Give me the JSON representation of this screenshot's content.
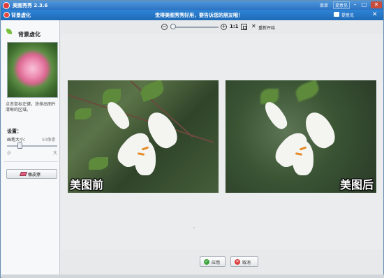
{
  "titlebar": {
    "app_title": "美图秀秀 2.3.6",
    "menu_label": "菜单",
    "feedback_label": "提意见",
    "minimize_glyph": "–",
    "maximize_glyph": "□",
    "close_glyph": "✕"
  },
  "subbar": {
    "title": "背景虚化",
    "center_text": "觉得美图秀秀好用，要告诉您的朋友哦！",
    "feedback_label": "提意见",
    "close_glyph": "✕"
  },
  "left_panel": {
    "title": "背景虚化",
    "description": "点击鼠标左键，涂抹出图片清晰的区域。",
    "settings_label": "设置：",
    "brush_size_label": "画笔大小：",
    "brush_size_value": "50像素",
    "brush_size_fraction": 0.25,
    "slider_min_label": "小",
    "slider_max_label": "大",
    "eraser_label": "橡皮擦"
  },
  "toolbar": {
    "zoom_out_glyph": "−",
    "zoom_in_glyph": "+",
    "one_to_one_label": "1:1",
    "reset_glyph": "✕",
    "reset_label": "重新开始"
  },
  "canvas": {
    "before_caption": "美图前",
    "after_caption": "美图后"
  },
  "buttons": {
    "apply_label": "应用",
    "apply_glyph": "✓",
    "cancel_label": "取消",
    "cancel_glyph": "✕"
  },
  "colors": {
    "titlebar": "#2c73c2",
    "apply_icon": "#3ca43c",
    "cancel_icon": "#d93b3b"
  }
}
